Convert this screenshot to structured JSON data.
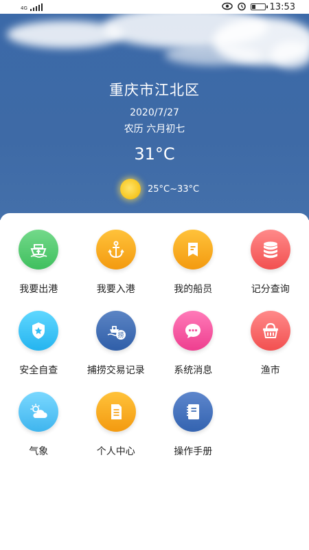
{
  "status_bar": {
    "network": "4G",
    "time": "13:53",
    "icons": [
      "signal-icon",
      "eye-icon",
      "alarm-icon",
      "battery-icon"
    ]
  },
  "weather": {
    "city": "重庆市江北区",
    "date": "2020/7/27",
    "lunar_date": "农历 六月初七",
    "temperature": "31°C",
    "range": "25°C~33°C",
    "condition_icon": "sun-icon"
  },
  "menu": {
    "items": [
      {
        "label": "我要出港",
        "icon": "ship-depart-icon",
        "color": "#4cc46a"
      },
      {
        "label": "我要入港",
        "icon": "anchor-icon",
        "color": "#f7a51c"
      },
      {
        "label": "我的船员",
        "icon": "crew-card-icon",
        "color": "#f7a51c"
      },
      {
        "label": "记分查询",
        "icon": "database-icon",
        "color": "#f35b5b"
      },
      {
        "label": "安全自查",
        "icon": "police-badge-icon",
        "color": "#2fbcf3"
      },
      {
        "label": "捕捞交易记录",
        "icon": "fishing-trade-icon",
        "color": "#3566ad"
      },
      {
        "label": "系统消息",
        "icon": "message-icon",
        "color": "#f2519c"
      },
      {
        "label": "渔市",
        "icon": "basket-icon",
        "color": "#f35b5b"
      },
      {
        "label": "气象",
        "icon": "weather-icon",
        "color": "#49bdf0"
      },
      {
        "label": "个人中心",
        "icon": "document-icon",
        "color": "#f7a51c"
      },
      {
        "label": "操作手册",
        "icon": "notebook-icon",
        "color": "#3d6cb6"
      }
    ]
  }
}
